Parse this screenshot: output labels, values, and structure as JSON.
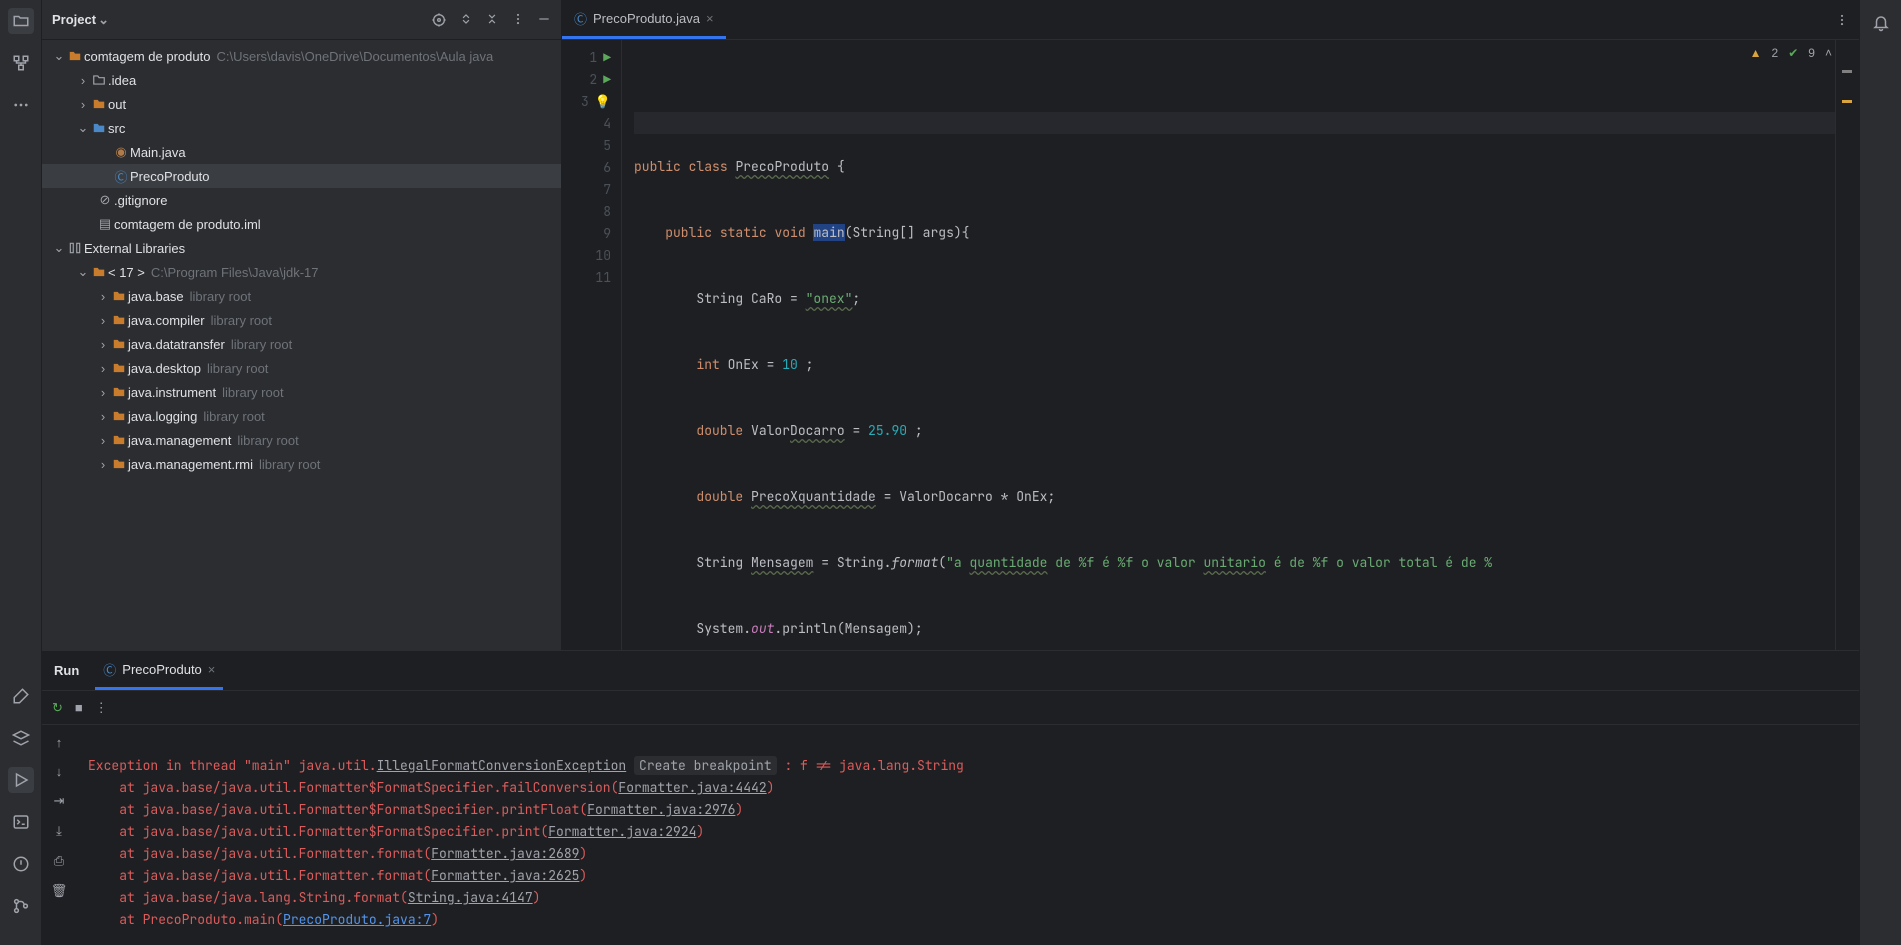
{
  "project": {
    "title": "Project",
    "root": {
      "name": "comtagem de produto",
      "path": "C:\\Users\\davis\\OneDrive\\Documentos\\Aula java"
    },
    "idea": ".idea",
    "out": "out",
    "src": "src",
    "main": "Main.java",
    "preco": "PrecoProduto",
    "gitignore": ".gitignore",
    "iml": "comtagem de produto.iml",
    "external": "External Libraries",
    "jdk": {
      "name": "< 17 >",
      "path": "C:\\Program Files\\Java\\jdk-17"
    },
    "libs": [
      {
        "name": "java.base",
        "hint": "library root"
      },
      {
        "name": "java.compiler",
        "hint": "library root"
      },
      {
        "name": "java.datatransfer",
        "hint": "library root"
      },
      {
        "name": "java.desktop",
        "hint": "library root"
      },
      {
        "name": "java.instrument",
        "hint": "library root"
      },
      {
        "name": "java.logging",
        "hint": "library root"
      },
      {
        "name": "java.management",
        "hint": "library root"
      },
      {
        "name": "java.management.rmi",
        "hint": "library root"
      }
    ]
  },
  "editor": {
    "tab": "PrecoProduto.java",
    "warnings": "2",
    "checks": "9",
    "code": {
      "l1a": "public",
      "l1b": "class",
      "l1c": "PrecoProduto",
      "l1d": " {",
      "l2a": "public",
      "l2b": "static",
      "l2c": "void",
      "l2d": "main",
      "l2e": "(String[] args){",
      "l3a": "String CaRo = ",
      "l3b": "\"onex\"",
      "l3c": ";",
      "l4a": "int",
      "l4b": " OnEx = ",
      "l4c": "10",
      "l4d": " ;",
      "l5a": "double",
      "l5b": " Valor",
      "l5c": "Docarro",
      "l5d": " = ",
      "l5e": "25.90",
      "l5f": " ;",
      "l6a": "double",
      "l6b": " ",
      "l6c": "PrecoXquantidade",
      "l6d": " = ValorDocarro * OnEx;",
      "l7a": "String ",
      "l7b": "Mensagem",
      "l7c": " = String.",
      "l7d": "format",
      "l7e": "(",
      "l7f": "\"a ",
      "l7g": "quantidade",
      "l7h": " de %f é %f o valor ",
      "l7i": "unitario",
      "l7j": " é de %f o valor total é de %",
      "l8a": "System.",
      "l8b": "out",
      "l8c": ".println(Mensagem);",
      "l9": "    }",
      "l10": "}"
    }
  },
  "run": {
    "title": "Run",
    "tab": "PrecoProduto",
    "createbp": "Create breakpoint",
    "lines": {
      "e1a": "Exception in thread \"main\" java.util.",
      "e1b": "IllegalFormatConversionException",
      "e1c": ": f != java.lang.String",
      "at": "    at ",
      "l2a": "java.base/java.util.Formatter$FormatSpecifier.failConversion(",
      "l2b": "Formatter.java:4442",
      "l2c": ")",
      "l3a": "java.base/java.util.Formatter$FormatSpecifier.printFloat(",
      "l3b": "Formatter.java:2976",
      "l3c": ")",
      "l4a": "java.base/java.util.Formatter$FormatSpecifier.print(",
      "l4b": "Formatter.java:2924",
      "l4c": ")",
      "l5a": "java.base/java.util.Formatter.format(",
      "l5b": "Formatter.java:2689",
      "l5c": ")",
      "l6a": "java.base/java.util.Formatter.format(",
      "l6b": "Formatter.java:2625",
      "l6c": ")",
      "l7a": "java.base/java.lang.String.format(",
      "l7b": "String.java:4147",
      "l7c": ")",
      "l8a": "PrecoProduto.main(",
      "l8b": "PrecoProduto.java:7",
      "l8c": ")"
    }
  }
}
